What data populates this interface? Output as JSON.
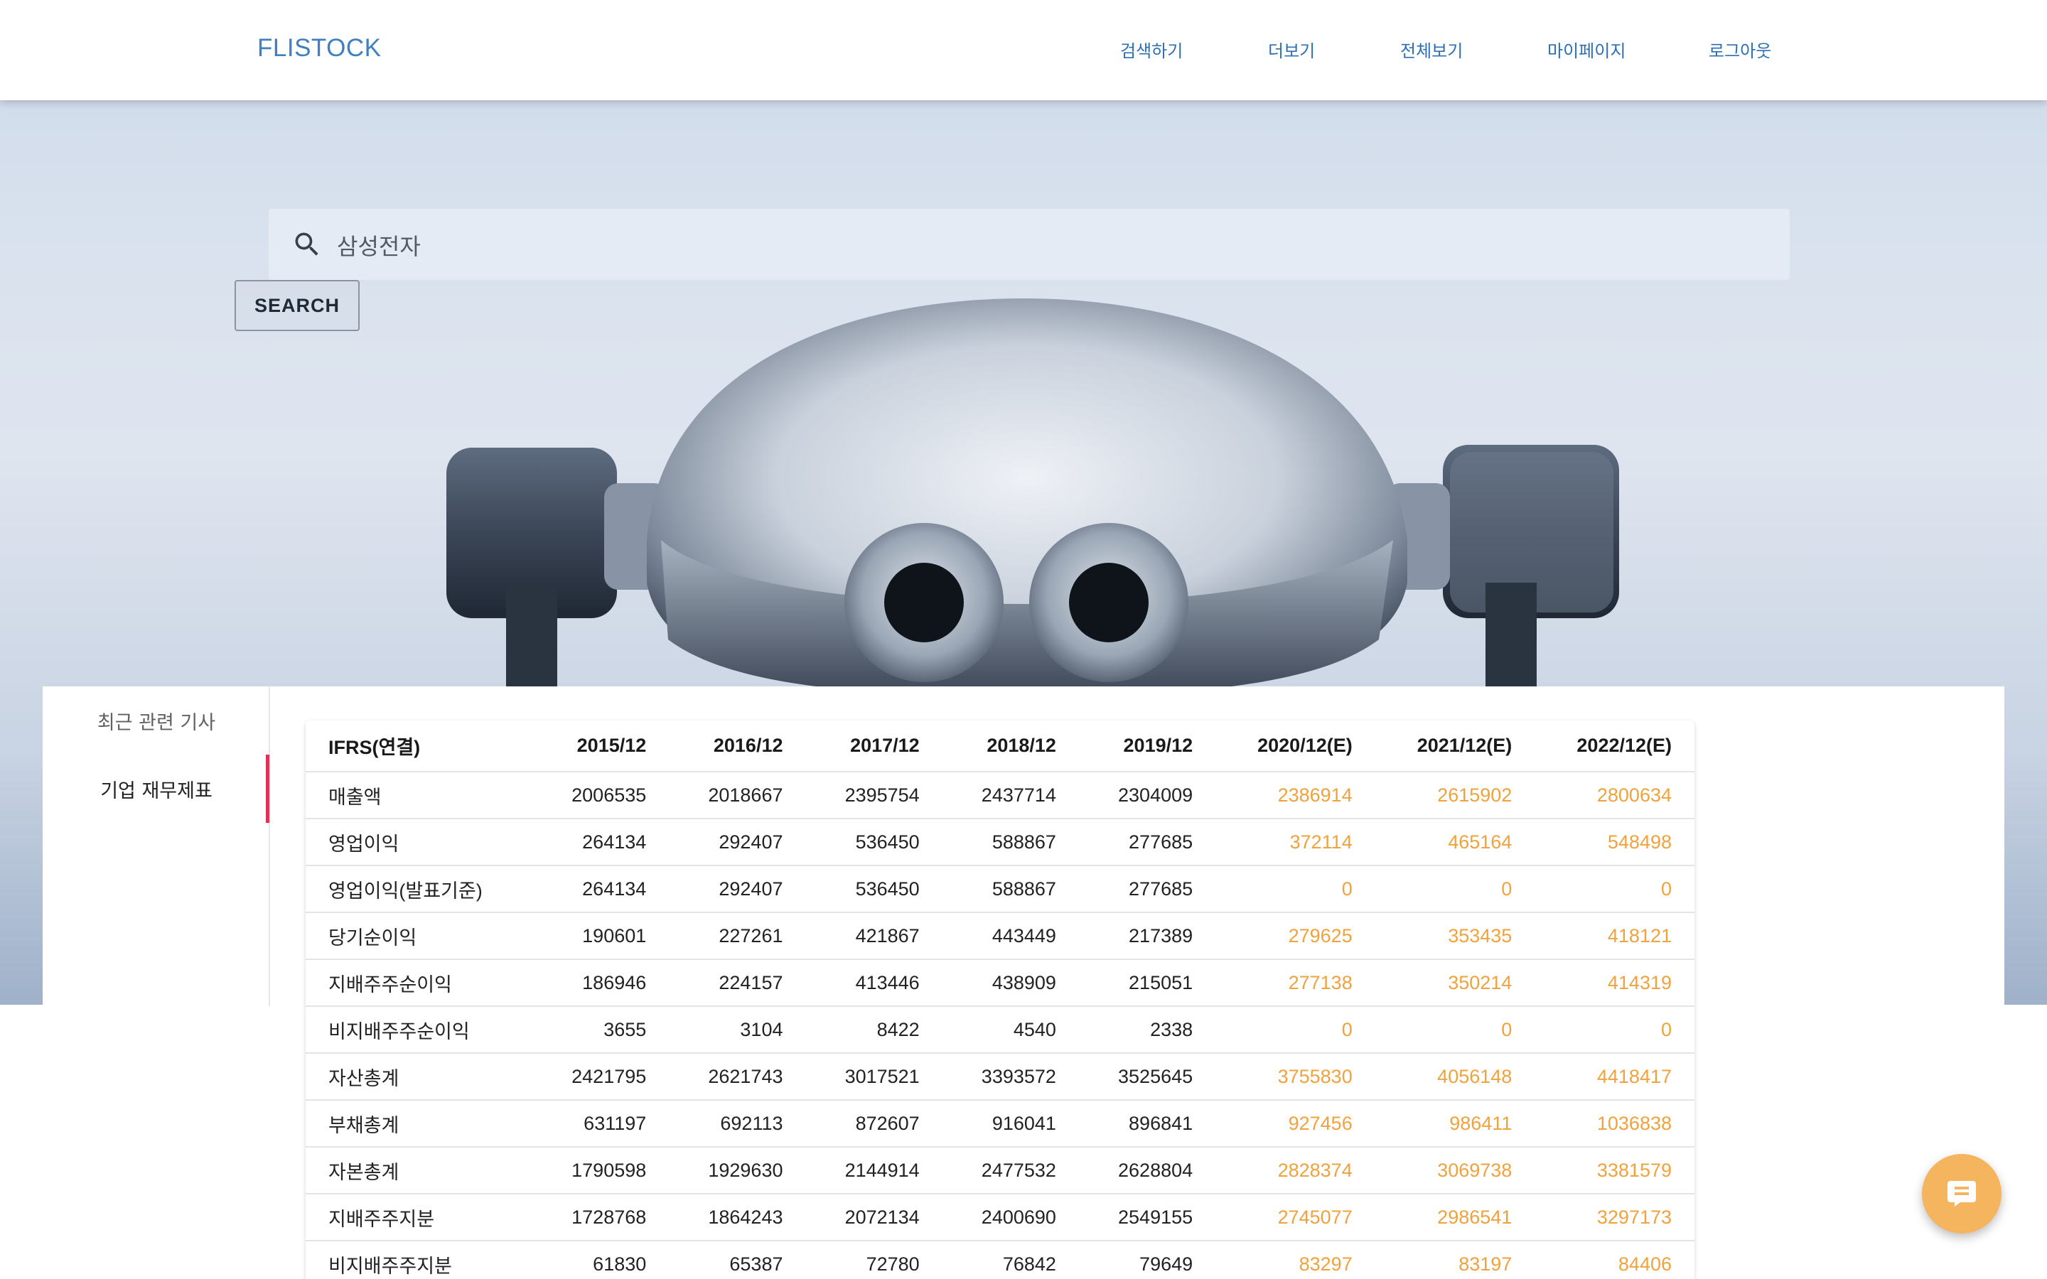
{
  "brand": "FLISTOCK",
  "nav": [
    {
      "label": "검색하기"
    },
    {
      "label": "더보기"
    },
    {
      "label": "전체보기"
    },
    {
      "label": "마이페이지"
    },
    {
      "label": "로그아웃"
    }
  ],
  "search": {
    "value": "삼성전자",
    "button_label": "SEARCH"
  },
  "side_tabs": [
    {
      "label": "최근 관련 기사"
    },
    {
      "label": "기업 재무제표"
    }
  ],
  "table": {
    "headers": [
      "IFRS(연결)",
      "2015/12",
      "2016/12",
      "2017/12",
      "2018/12",
      "2019/12",
      "2020/12(E)",
      "2021/12(E)",
      "2022/12(E)"
    ],
    "rows": [
      [
        "매출액",
        "2006535",
        "2018667",
        "2395754",
        "2437714",
        "2304009",
        "2386914",
        "2615902",
        "2800634"
      ],
      [
        "영업이익",
        "264134",
        "292407",
        "536450",
        "588867",
        "277685",
        "372114",
        "465164",
        "548498"
      ],
      [
        "영업이익(발표기준)",
        "264134",
        "292407",
        "536450",
        "588867",
        "277685",
        "0",
        "0",
        "0"
      ],
      [
        "당기순이익",
        "190601",
        "227261",
        "421867",
        "443449",
        "217389",
        "279625",
        "353435",
        "418121"
      ],
      [
        "지배주주순이익",
        "186946",
        "224157",
        "413446",
        "438909",
        "215051",
        "277138",
        "350214",
        "414319"
      ],
      [
        "비지배주주순이익",
        "3655",
        "3104",
        "8422",
        "4540",
        "2338",
        "0",
        "0",
        "0"
      ],
      [
        "자산총계",
        "2421795",
        "2621743",
        "3017521",
        "3393572",
        "3525645",
        "3755830",
        "4056148",
        "4418417"
      ],
      [
        "부채총계",
        "631197",
        "692113",
        "872607",
        "916041",
        "896841",
        "927456",
        "986411",
        "1036838"
      ],
      [
        "자본총계",
        "1790598",
        "1929630",
        "2144914",
        "2477532",
        "2628804",
        "2828374",
        "3069738",
        "3381579"
      ],
      [
        "지배주주지분",
        "1728768",
        "1864243",
        "2072134",
        "2400690",
        "2549155",
        "2745077",
        "2986541",
        "3297173"
      ],
      [
        "비지배주주지분",
        "61830",
        "65387",
        "72780",
        "76842",
        "79649",
        "83297",
        "83197",
        "84406"
      ]
    ]
  },
  "colors": {
    "brand": "#3f7fc3",
    "estimate": "#f2a23c",
    "active_indicator": "#e0335a",
    "fab": "#f5b55f"
  }
}
